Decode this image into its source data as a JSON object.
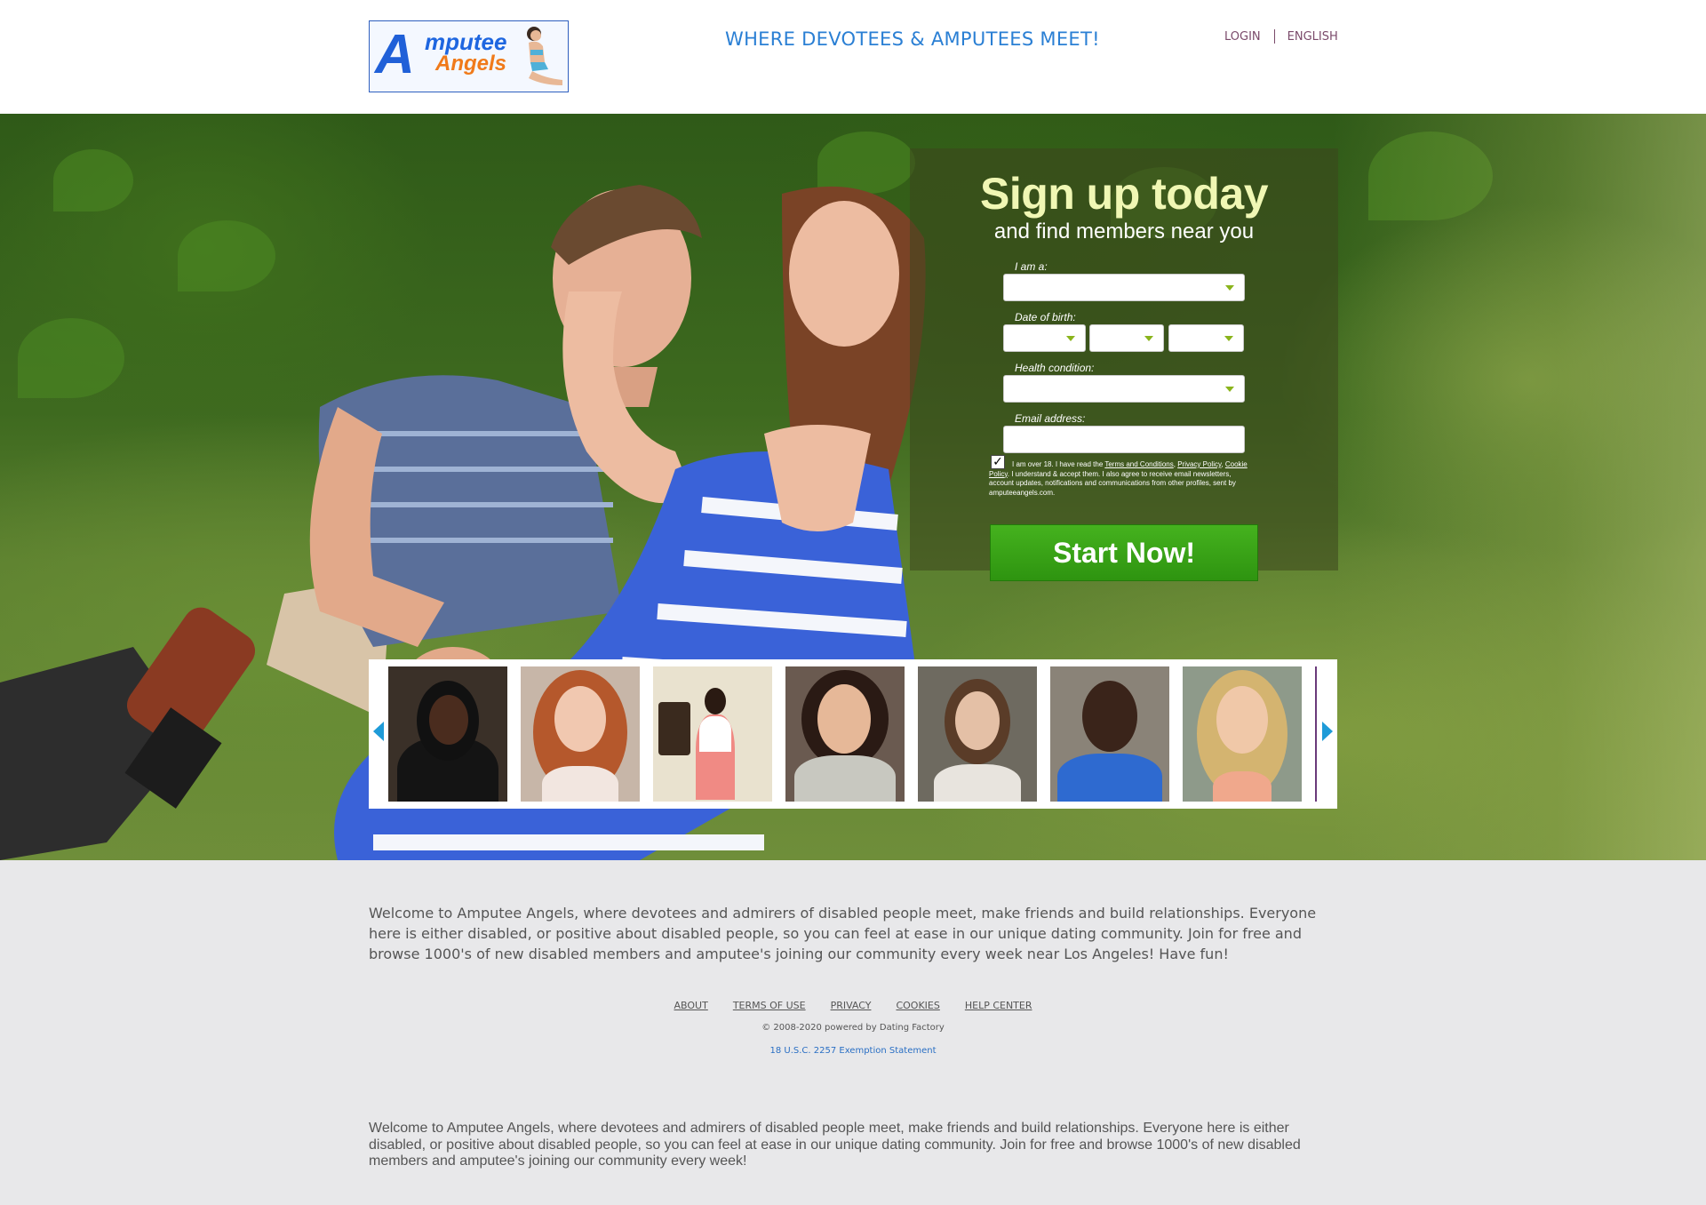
{
  "header": {
    "logo": {
      "line1": "mputee",
      "line2": "Angels",
      "initial": "A"
    },
    "tagline": "WHERE DEVOTEES & AMPUTEES MEET!",
    "login": "LOGIN",
    "language": "ENGLISH"
  },
  "signup": {
    "title": "Sign up today",
    "subtitle": "and find members near you",
    "i_am_label": "I am a:",
    "dob_label": "Date of birth:",
    "health_label": "Health condition:",
    "email_label": "Email address:",
    "checkbox_mark": "✓",
    "terms_pre": "I am over 18. I have read the ",
    "terms_link": "Terms and Conditions",
    "terms_sep1": ", ",
    "privacy_link": "Privacy Policy",
    "terms_sep2": ", ",
    "cookie_link": "Cookie Policy",
    "terms_post": ". I understand & accept them. I also agree to receive email newsletters, account updates, notifications and communications from other profiles, sent by amputeeangels.com.",
    "button": "Start Now!"
  },
  "carousel": {
    "photos": [
      {
        "name": "member-photo-1"
      },
      {
        "name": "member-photo-2"
      },
      {
        "name": "member-photo-3"
      },
      {
        "name": "member-photo-4"
      },
      {
        "name": "member-photo-5"
      },
      {
        "name": "member-photo-6"
      },
      {
        "name": "member-photo-7"
      }
    ]
  },
  "welcome": "Welcome to Amputee Angels, where devotees and admirers of disabled people meet, make friends and build relationships. Everyone here is either disabled, or positive about disabled people, so you can feel at ease in our unique dating community. Join for free and browse 1000's of new disabled members and amputee's joining our community every week near Los Angeles! Have fun!",
  "footer": {
    "links": [
      "ABOUT",
      "TERMS OF USE",
      "PRIVACY",
      "COOKIES",
      "HELP CENTER"
    ],
    "copyright": "© 2008-2020 powered by Dating Factory",
    "exemption": "18 U.S.C. 2257 Exemption Statement"
  },
  "welcome2": "Welcome to Amputee Angels, where devotees and admirers of disabled people meet, make friends and build relationships. Everyone here is either disabled, or positive about disabled people, so you can feel at ease in our unique dating community. Join for free and browse 1000's of new disabled members and amputee's joining our community every week!",
  "colors": {
    "tagline": "#2a7fd4",
    "nav": "#7a4a6a",
    "headline": "#f0f7b4",
    "button": "#2e9410",
    "arrow": "#1e9bd8"
  }
}
